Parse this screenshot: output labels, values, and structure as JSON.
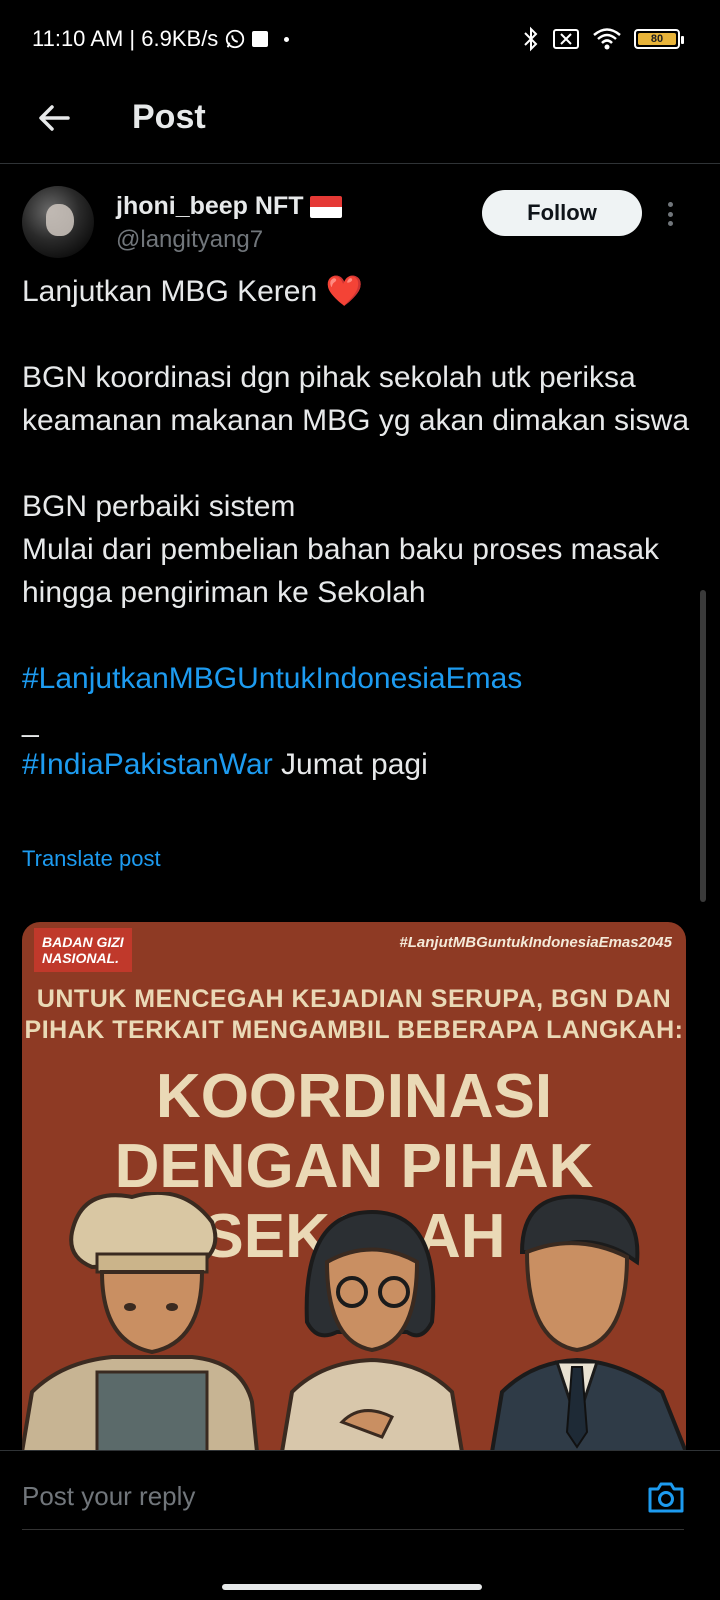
{
  "status_bar": {
    "time_info": "11:10 AM | 6.9KB/s",
    "battery": "80"
  },
  "header": {
    "title": "Post"
  },
  "author": {
    "name": "jhoni_beep NFT",
    "handle": "@langityang7",
    "follow_label": "Follow"
  },
  "post": {
    "line1": "Lanjutkan MBG Keren ",
    "heart": "❤️",
    "para2": "BGN koordinasi dgn pihak  sekolah utk periksa keamanan makanan MBG yg akan dimakan siswa",
    "para3_line1": "BGN perbaiki sistem",
    "para3_line2": "Mulai dari pembelian bahan baku proses masak hingga pengiriman ke Sekolah",
    "hashtag1": "#LanjutkanMBGUntukIndonesiaEmas",
    "dash": "_",
    "hashtag2": "#IndiaPakistanWar",
    "tail": " Jumat pagi",
    "translate_label": "Translate post"
  },
  "image": {
    "logo_text": "BADAN GIZI NASIONAL.",
    "hashtag": "#LanjutMBGuntukIndonesiaEmas2045",
    "subtitle": "UNTUK MENCEGAH KEJADIAN SERUPA, BGN DAN PIHAK TERKAIT MENGAMBIL BEBERAPA LANGKAH:",
    "headline": "KOORDINASI DENGAN PIHAK SEKOLAH"
  },
  "reply": {
    "placeholder": "Post your reply"
  },
  "colors": {
    "accent": "#1d9bf0",
    "background": "#000000",
    "image_bg": "#8e3a24"
  }
}
